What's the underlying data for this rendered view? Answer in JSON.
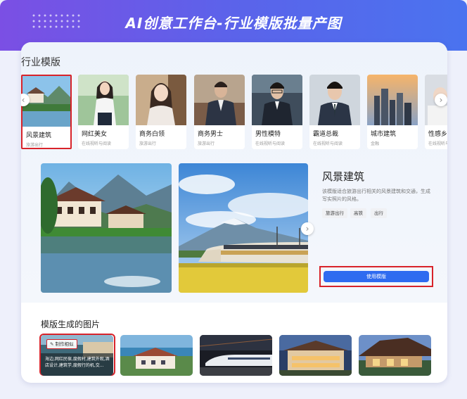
{
  "header": {
    "title": "AI创意工作台-行业模版批量产图"
  },
  "templates_section": {
    "title": "行业模版"
  },
  "templates": [
    {
      "name": "风景建筑",
      "sub": "旅游出行"
    },
    {
      "name": "网红美女",
      "sub": "在线视听与阅读"
    },
    {
      "name": "商务白领",
      "sub": "旅游出行"
    },
    {
      "name": "商务男士",
      "sub": "旅游出行"
    },
    {
      "name": "男性模特",
      "sub": "在线视听与阅读"
    },
    {
      "name": "霸道总裁",
      "sub": "在线视听与阅读"
    },
    {
      "name": "城市建筑",
      "sub": "金融"
    },
    {
      "name": "性感乡",
      "sub": "在线视听与阅读"
    }
  ],
  "detail": {
    "title": "风景建筑",
    "description": "该模版适合旅游出行相关的风景建筑和交通，生成写实照片的风格。",
    "tags": [
      "旅游出行",
      "高铁",
      "出行"
    ],
    "use_button": "使用模版"
  },
  "generated_section": {
    "title": "模版生成的图片",
    "make_similar": "制作相似",
    "first_caption": "海边,网红民宿,度假村,建筑外观,酒店设计,建筑学,度假行的机,交..."
  },
  "icons": {
    "prev": "chevron-left-icon",
    "next": "chevron-right-icon",
    "edit": "edit-icon"
  },
  "colors": {
    "accent_blue": "#2f6bf0",
    "highlight_red": "#d8232a",
    "banner_start": "#7b4fe4",
    "banner_end": "#4a73ef"
  }
}
